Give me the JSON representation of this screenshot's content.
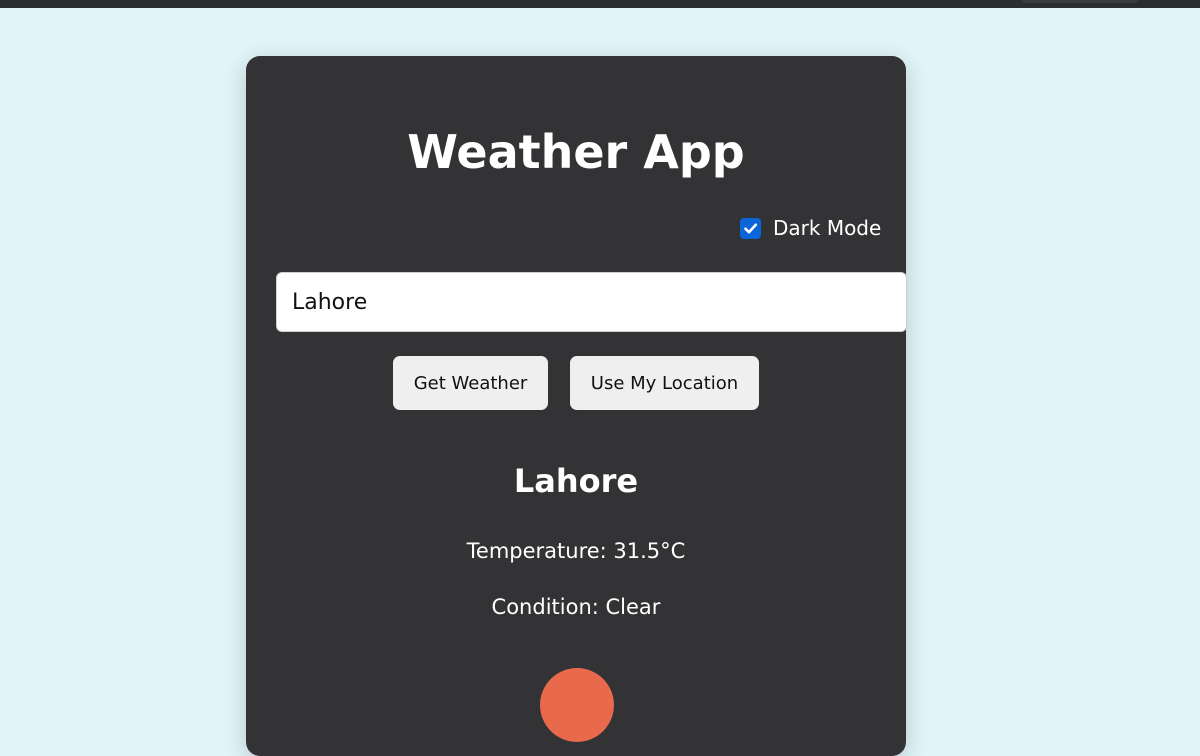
{
  "app": {
    "title": "Weather App"
  },
  "dark_mode": {
    "label": "Dark Mode",
    "checked": true,
    "checkbox_color": "#0a66d8"
  },
  "search": {
    "value": "Lahore",
    "placeholder": ""
  },
  "actions": {
    "get_weather_label": "Get Weather",
    "use_location_label": "Use My Location"
  },
  "result": {
    "city": "Lahore",
    "temperature_text": "Temperature: 31.5°C",
    "condition_text": "Condition: Clear",
    "icon": "sun-icon",
    "icon_color": "#e8694c"
  },
  "theme": {
    "page_background": "#dff5f8",
    "card_background": "#333335",
    "button_background": "#efefef"
  }
}
